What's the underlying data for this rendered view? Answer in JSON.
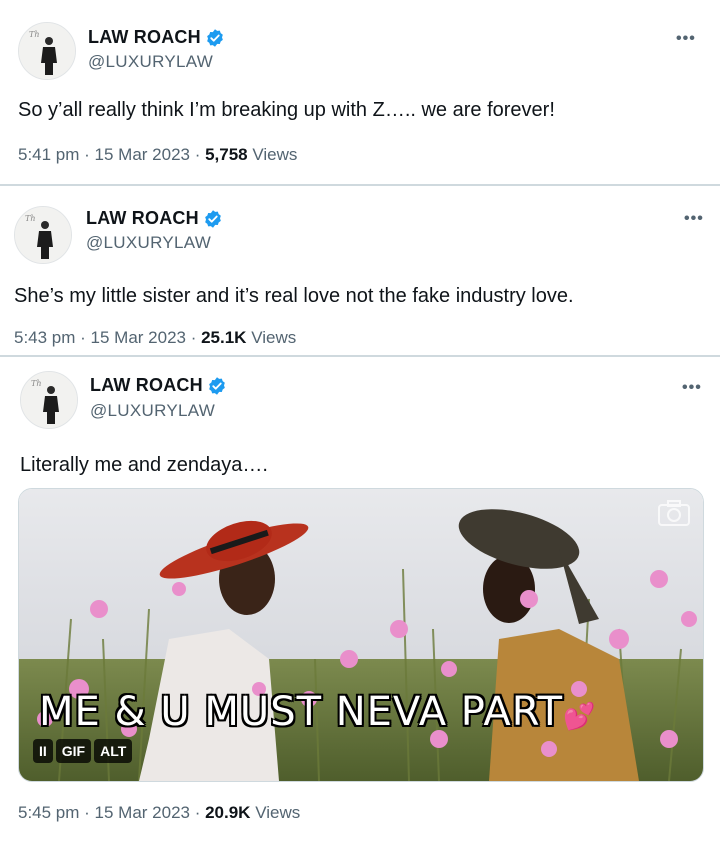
{
  "tweets": [
    {
      "author_name": "LAW ROACH",
      "handle": "@LUXURYLAW",
      "more": "•••",
      "text": "So y’all really think I’m breaking up with Z….. we are forever!",
      "time": "5:41 pm · 15 Mar 2023 · ",
      "views_count": "5,758",
      "views_label": " Views"
    },
    {
      "author_name": "LAW ROACH",
      "handle": "@LUXURYLAW",
      "more": "•••",
      "text": "She’s my little sister and it’s real love not the fake industry love.",
      "time": "5:43 pm · 15 Mar 2023 · ",
      "views_count": "25.1K",
      "views_label": " Views"
    },
    {
      "author_name": "LAW ROACH",
      "handle": "@LUXURYLAW",
      "more": "•••",
      "text": "Literally me and zendaya….",
      "time": "5:45 pm · 15 Mar 2023 · ",
      "views_count": "20.9K",
      "views_label": " Views",
      "media": {
        "caption": "ME & U MUST NEVA PART",
        "pause_label": "II",
        "gif_label": "GIF",
        "alt_label": "ALT"
      }
    }
  ],
  "colors": {
    "verified": "#1d9bf0",
    "secondary_text": "#536471",
    "separator": "#cfd9de"
  }
}
